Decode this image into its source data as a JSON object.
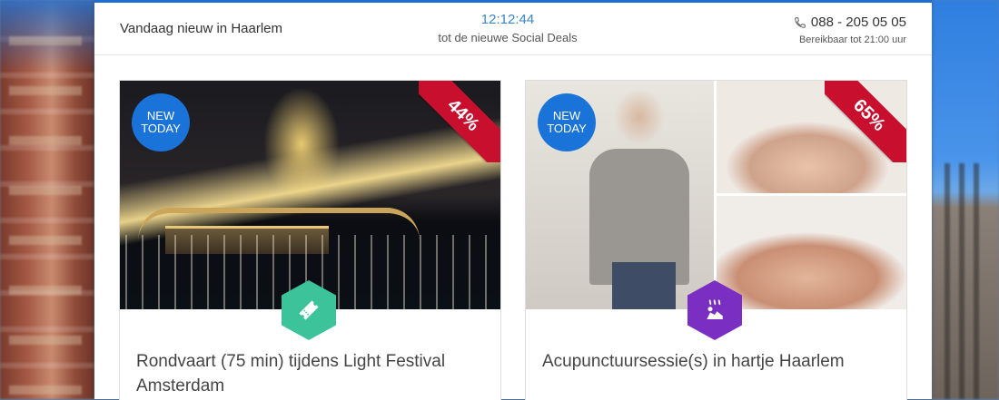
{
  "header": {
    "city_text": "Vandaag nieuw in Haarlem",
    "countdown_time": "12:12:44",
    "countdown_text": "tot de nieuwe Social Deals",
    "phone": "088 - 205 05 05",
    "hours": "Bereikbaar tot 21:00 uur"
  },
  "deals": [
    {
      "badge_line1": "NEW",
      "badge_line2": "TODAY",
      "discount": "44%",
      "category_icon": "ticket-icon",
      "title": "Rondvaart (75 min) tijdens Light Festival Amsterdam"
    },
    {
      "badge_line1": "NEW",
      "badge_line2": "TODAY",
      "discount": "65%",
      "category_icon": "spa-massage-icon",
      "title": "Acupunctuursessie(s) in hartje Haarlem"
    }
  ],
  "colors": {
    "accent_blue": "#1a73d9",
    "ribbon_red": "#c8102e",
    "ticket_green": "#3cc39a",
    "spa_purple": "#7b2fc2"
  }
}
